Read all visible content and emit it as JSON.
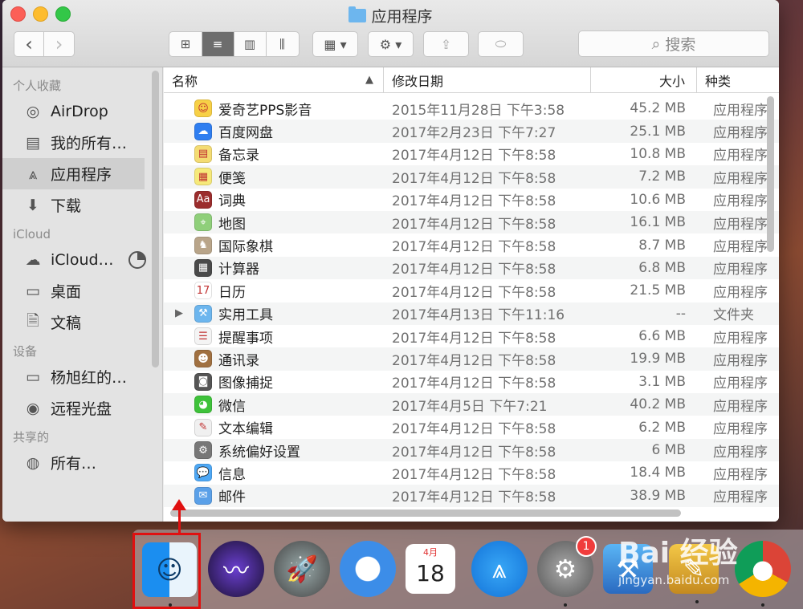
{
  "window": {
    "title": "应用程序",
    "toolbar": {
      "back": "‹",
      "forward": "›",
      "view_icons": "⊞",
      "view_list": "≡",
      "view_columns": "▥",
      "view_cover": "⫼",
      "group": "▦ ▾",
      "action": "⚙ ▾",
      "share": "⇪",
      "tag": "⬭"
    },
    "search": {
      "placeholder": "搜索",
      "icon": "search-icon"
    }
  },
  "sidebar": {
    "sections": [
      {
        "label": "个人收藏",
        "items": [
          {
            "label": "AirDrop",
            "icon": "airdrop-icon",
            "glyph": "◎"
          },
          {
            "label": "我的所有…",
            "icon": "all-files-icon",
            "glyph": "▤"
          },
          {
            "label": "应用程序",
            "icon": "applications-icon",
            "glyph": "⩓",
            "active": true
          },
          {
            "label": "下载",
            "icon": "download-icon",
            "glyph": "⬇"
          }
        ]
      },
      {
        "label": "iCloud",
        "items": [
          {
            "label": "iCloud…",
            "icon": "cloud-icon",
            "glyph": "☁"
          },
          {
            "label": "桌面",
            "icon": "desktop-icon",
            "glyph": "▭"
          },
          {
            "label": "文稿",
            "icon": "documents-icon",
            "glyph": "🗎"
          }
        ]
      },
      {
        "label": "设备",
        "items": [
          {
            "label": "杨旭红的…",
            "icon": "laptop-icon",
            "glyph": "▭"
          },
          {
            "label": "远程光盘",
            "icon": "disc-icon",
            "glyph": "◉"
          }
        ]
      },
      {
        "label": "共享的",
        "items": [
          {
            "label": "所有…",
            "icon": "network-icon",
            "glyph": "◍"
          }
        ]
      }
    ]
  },
  "columns": {
    "name": "名称",
    "date": "修改日期",
    "size": "大小",
    "kind": "种类"
  },
  "files": [
    {
      "name": "爱奇艺PPS影音",
      "date": "2015年11月28日 下午3:58",
      "size": "45.2 MB",
      "kind": "应用程序",
      "icon": "iqiyi-icon",
      "glyph": "☺",
      "color": "#f7d046"
    },
    {
      "name": "百度网盘",
      "date": "2017年2月23日 下午7:27",
      "size": "25.1 MB",
      "kind": "应用程序",
      "icon": "baidu-disk-icon",
      "glyph": "☁",
      "color": "#2f7ef0"
    },
    {
      "name": "备忘录",
      "date": "2017年4月12日 下午8:58",
      "size": "10.8 MB",
      "kind": "应用程序",
      "icon": "notes-icon",
      "glyph": "▤",
      "color": "#f4dc73"
    },
    {
      "name": "便笺",
      "date": "2017年4月12日 下午8:58",
      "size": "7.2 MB",
      "kind": "应用程序",
      "icon": "stickies-icon",
      "glyph": "▦",
      "color": "#f6e97a"
    },
    {
      "name": "词典",
      "date": "2017年4月12日 下午8:58",
      "size": "10.6 MB",
      "kind": "应用程序",
      "icon": "dictionary-icon",
      "glyph": "Aa",
      "color": "#9b2d2d"
    },
    {
      "name": "地图",
      "date": "2017年4月12日 下午8:58",
      "size": "16.1 MB",
      "kind": "应用程序",
      "icon": "maps-icon",
      "glyph": "⌖",
      "color": "#8fcf7a"
    },
    {
      "name": "国际象棋",
      "date": "2017年4月12日 下午8:58",
      "size": "8.7 MB",
      "kind": "应用程序",
      "icon": "chess-icon",
      "glyph": "♞",
      "color": "#b9a58a"
    },
    {
      "name": "计算器",
      "date": "2017年4月12日 下午8:58",
      "size": "6.8 MB",
      "kind": "应用程序",
      "icon": "calculator-icon",
      "glyph": "▦",
      "color": "#4a4a4a"
    },
    {
      "name": "日历",
      "date": "2017年4月12日 下午8:58",
      "size": "21.5 MB",
      "kind": "应用程序",
      "icon": "calendar-icon",
      "glyph": "17",
      "color": "#ffffff"
    },
    {
      "name": "实用工具",
      "date": "2017年4月13日 下午11:16",
      "size": "--",
      "kind": "文件夹",
      "icon": "folder-icon",
      "glyph": "⚒",
      "color": "#6db6ee",
      "folder": true
    },
    {
      "name": "提醒事项",
      "date": "2017年4月12日 下午8:58",
      "size": "6.6 MB",
      "kind": "应用程序",
      "icon": "reminders-icon",
      "glyph": "☰",
      "color": "#f4f4f4"
    },
    {
      "name": "通讯录",
      "date": "2017年4月12日 下午8:58",
      "size": "19.9 MB",
      "kind": "应用程序",
      "icon": "contacts-icon",
      "glyph": "☻",
      "color": "#a07040"
    },
    {
      "name": "图像捕捉",
      "date": "2017年4月12日 下午8:58",
      "size": "3.1 MB",
      "kind": "应用程序",
      "icon": "image-capture-icon",
      "glyph": "◙",
      "color": "#555555"
    },
    {
      "name": "微信",
      "date": "2017年4月5日 下午7:21",
      "size": "40.2 MB",
      "kind": "应用程序",
      "icon": "wechat-icon",
      "glyph": "◕",
      "color": "#3ec23a"
    },
    {
      "name": "文本编辑",
      "date": "2017年4月12日 下午8:58",
      "size": "6.2 MB",
      "kind": "应用程序",
      "icon": "textedit-icon",
      "glyph": "✎",
      "color": "#f0f0f0"
    },
    {
      "name": "系统偏好设置",
      "date": "2017年4月12日 下午8:58",
      "size": "6 MB",
      "kind": "应用程序",
      "icon": "system-prefs-icon",
      "glyph": "⚙",
      "color": "#777777"
    },
    {
      "name": "信息",
      "date": "2017年4月12日 下午8:58",
      "size": "18.4 MB",
      "kind": "应用程序",
      "icon": "messages-icon",
      "glyph": "💬",
      "color": "#4ea8f5"
    },
    {
      "name": "邮件",
      "date": "2017年4月12日 下午8:58",
      "size": "38.9 MB",
      "kind": "应用程序",
      "icon": "mail-icon",
      "glyph": "✉",
      "color": "#5aa0e8"
    }
  ],
  "dock": {
    "items": [
      {
        "name": "finder",
        "icon": "finder-icon",
        "glyph": "☺",
        "bg": "linear-gradient(90deg,#1b8ef0 50%,#e9f4fc 50%)",
        "running": true
      },
      {
        "name": "siri",
        "icon": "siri-icon",
        "glyph": "〰",
        "bg": "radial-gradient(circle,#6a3fd0,#1a1030)",
        "running": false
      },
      {
        "name": "launchpad",
        "icon": "launchpad-icon",
        "glyph": "🚀",
        "bg": "radial-gradient(circle,#9aa,#444)",
        "running": false
      },
      {
        "name": "safari",
        "icon": "safari-icon",
        "glyph": "✦",
        "bg": "radial-gradient(circle,#fff 30%,#3c8de8 32%)",
        "running": false
      },
      {
        "name": "calendar",
        "icon": "calendar-dock-icon",
        "glyph": "18",
        "month": "4月",
        "bg": "#ffffff",
        "running": false
      },
      {
        "name": "app-store",
        "icon": "app-store-icon",
        "glyph": "⩓",
        "bg": "radial-gradient(circle,#38a7f6,#1272d8)",
        "running": false
      },
      {
        "name": "system-preferences",
        "icon": "system-prefs-dock-icon",
        "glyph": "⚙",
        "bg": "radial-gradient(circle,#aaa,#555)",
        "badge": "1",
        "running": true
      },
      {
        "name": "xcode",
        "icon": "xcode-icon",
        "glyph": "⚒",
        "bg": "linear-gradient(#5ab5f5,#2a6ac0)",
        "running": false
      },
      {
        "name": "utility",
        "icon": "utility-icon",
        "glyph": "✎",
        "bg": "linear-gradient(#f3c847,#c48a1f)",
        "running": true
      },
      {
        "name": "chrome",
        "icon": "chrome-icon",
        "glyph": "●",
        "bg": "conic-gradient(#db4437 0 33%,#f4b400 33% 66%,#0f9d58 66%)",
        "running": true
      }
    ]
  },
  "watermark": {
    "brand": "Bai 经验",
    "url": "jingyan.baidu.com"
  },
  "colors": {
    "accent_highlight": "#e01010",
    "selection": "#cfcfcf"
  }
}
